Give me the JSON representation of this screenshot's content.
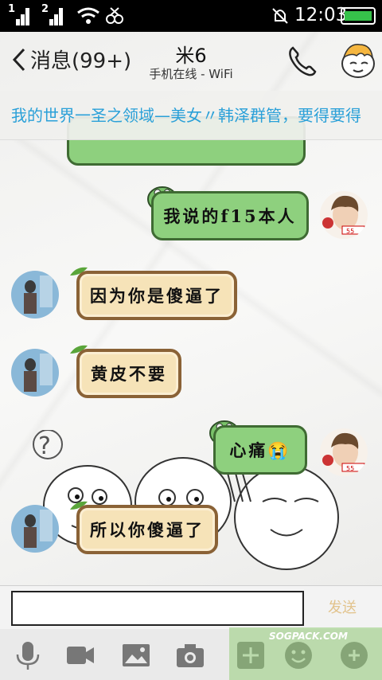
{
  "status_bar": {
    "sim1_label": "1",
    "sim2_label": "2",
    "time": "12:03",
    "icons": [
      "signal-icon",
      "signal-icon",
      "wifi-icon",
      "data-transfer-icon",
      "vibrate-off-icon",
      "battery-icon"
    ]
  },
  "header": {
    "back_label": "消息(99+)",
    "contact_name": "米6",
    "contact_status": "手机在线 - WiFi",
    "icons": [
      "back-chevron-icon",
      "phone-icon",
      "friend-avatar"
    ]
  },
  "banner": {
    "text": "我的世界一圣之领域—美女〃韩泽群管，要得要得"
  },
  "messages": [
    {
      "side": "left",
      "text": ""
    },
    {
      "side": "right",
      "text": "我说的f15本人"
    },
    {
      "side": "left",
      "text": "因为你是傻逼了"
    },
    {
      "side": "left",
      "text": "黄皮不要"
    },
    {
      "side": "right",
      "text": "心痛😭"
    },
    {
      "side": "left",
      "text": "所以你傻逼了"
    }
  ],
  "input": {
    "value": "",
    "send_label": "发送"
  },
  "toolbar": {
    "icons": [
      "microphone-icon",
      "video-icon",
      "image-icon",
      "camera-icon",
      "plus-icon",
      "emoji-icon",
      "more-icon"
    ]
  },
  "watermark": {
    "text": "SOGPACK.COM"
  },
  "colors": {
    "banner_text": "#2aa0d8",
    "left_bubble_fill": "#f6e3b8",
    "left_bubble_border": "#8a6236",
    "right_bubble_fill": "#8ed07e",
    "right_bubble_border": "#3f6b33"
  }
}
